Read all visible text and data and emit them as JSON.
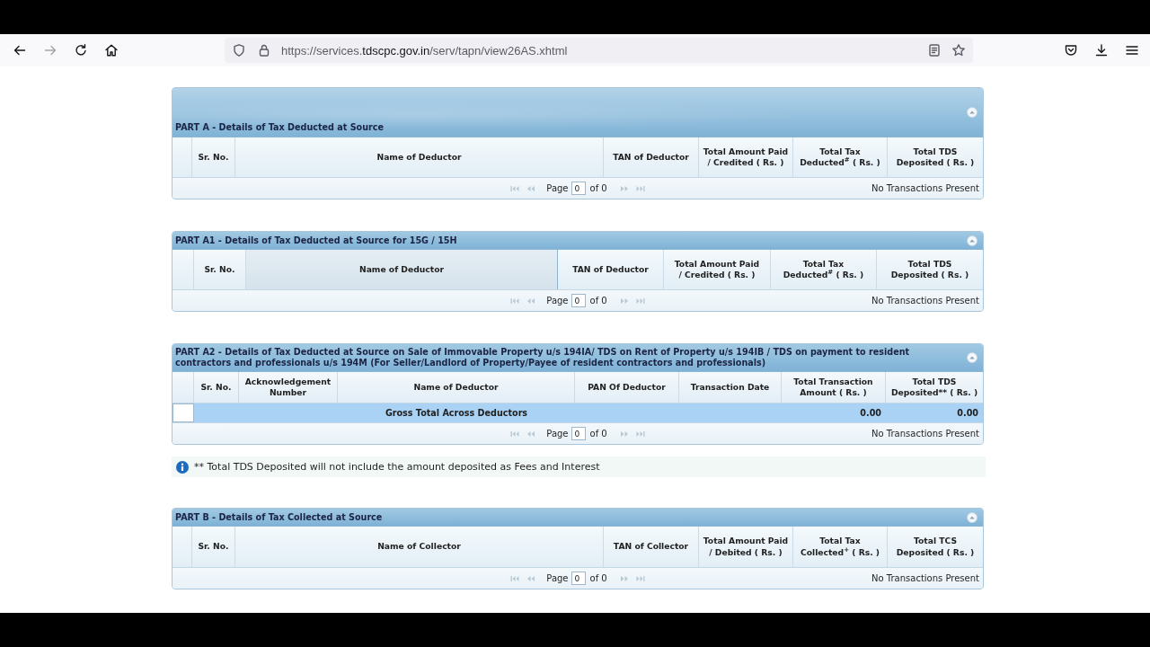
{
  "browser": {
    "forward_disabled": true,
    "url": {
      "prefix": "https://services.",
      "domain": "tdscpc.gov.in",
      "path": "/serv/tapn/view26AS.xhtml"
    }
  },
  "panels": [
    {
      "kind": "banner_table",
      "title": "PART A - Details of Tax Deducted at Source",
      "expanded": true,
      "columns": [
        {
          "label": "Sr. No."
        },
        {
          "label": "Name of Deductor"
        },
        {
          "label": "TAN of Deductor"
        },
        {
          "label": "Total Amount Paid / Credited ( Rs. )"
        },
        {
          "label": "Total Tax Deducted$^{#}$ ( Rs. )"
        },
        {
          "label": "Total TDS Deposited ( Rs. )"
        }
      ],
      "pager": {
        "nav_disabled": true,
        "label": "Page",
        "value": "0",
        "total": "of 0",
        "status": "No Transactions Present"
      }
    },
    {
      "kind": "table",
      "title": "PART A1 - Details of Tax Deducted at Source for 15G / 15H",
      "expanded": true,
      "columns": [
        {
          "label": "Sr. No.",
          "hovered": false
        },
        {
          "label": "Name of Deductor",
          "hovered": true
        },
        {
          "label": "TAN of Deductor",
          "hovered": false
        },
        {
          "label": "Total Amount Paid / Credited ( Rs. )",
          "hovered": false
        },
        {
          "label": "Total Tax Deducted$^{#}$ ( Rs. )",
          "hovered": false
        },
        {
          "label": "Total TDS Deposited ( Rs. )",
          "hovered": false
        }
      ],
      "pager": {
        "nav_disabled": true,
        "label": "Page",
        "value": "0",
        "total": "of 0",
        "status": "No Transactions Present"
      }
    },
    {
      "kind": "table",
      "title": "PART A2 - Details of Tax Deducted at Source on Sale of Immovable Property u/s 194IA/ TDS on Rent of Property u/s 194IB / TDS on payment to resident contractors and professionals u/s 194M (For Seller/Landlord of Property/Payee of resident contractors and professionals)",
      "expanded": true,
      "columns": [
        {
          "label": "Sr. No."
        },
        {
          "label": "Acknowledgement Number"
        },
        {
          "label": "Name of Deductor"
        },
        {
          "label": "PAN Of Deductor"
        },
        {
          "label": "Transaction Date"
        },
        {
          "label": "Total Transaction Amount ( Rs. )"
        },
        {
          "label": "Total TDS Deposited** ( Rs. )"
        }
      ],
      "rows": [
        {
          "kind": "total",
          "label": "Gross Total Across Deductors",
          "total_transaction_amount": "0.00",
          "total_tds_deposited": "0.00"
        }
      ],
      "pager": {
        "nav_disabled": true,
        "label": "Page",
        "value": "0",
        "total": "of 0",
        "status": "No Transactions Present"
      }
    },
    {
      "kind": "note",
      "text": "** Total TDS Deposited will not include the amount deposited as Fees and Interest"
    },
    {
      "kind": "table",
      "title": "PART B - Details of Tax Collected at Source",
      "expanded": true,
      "columns": [
        {
          "label": "Sr. No."
        },
        {
          "label": "Name of Collector"
        },
        {
          "label": "TAN of Collector"
        },
        {
          "label": "Total Amount Paid / Debited ( Rs. )"
        },
        {
          "label": "Total Tax Collected$^{+}$ ( Rs. )"
        },
        {
          "label": "Total TCS Deposited ( Rs. )"
        }
      ],
      "pager": {
        "nav_disabled": true,
        "label": "Page",
        "value": "0",
        "total": "of 0",
        "status": "No Transactions Present"
      }
    }
  ]
}
